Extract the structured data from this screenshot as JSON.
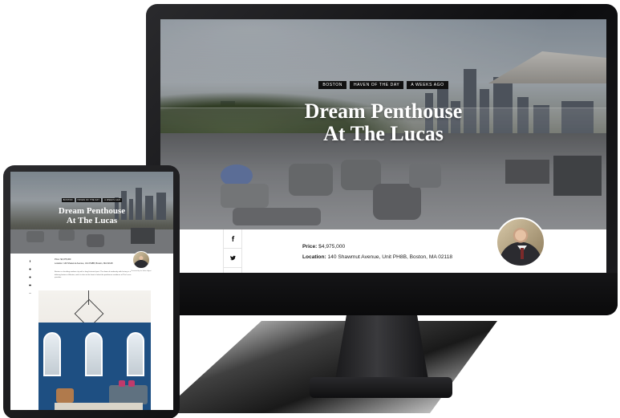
{
  "desktop": {
    "tags": [
      "Boston",
      "Haven of the Day",
      "A Weeks Ago"
    ],
    "title_line1": "Dream Penthouse",
    "title_line2": "At The Lucas",
    "price_label": "Price:",
    "price_value": "$4,975,000",
    "location_label": "Location:",
    "location_value": "140 Shawmut Avenue, Unit PH8B, Boston, MA 02118",
    "social": [
      {
        "icon": "facebook-icon",
        "glyph": "f"
      },
      {
        "icon": "twitter-icon",
        "glyph": "t"
      }
    ]
  },
  "tablet": {
    "tags": [
      "Boston",
      "Haven of the Day",
      "A Weeks Ago"
    ],
    "title_line1": "Dream Penthouse",
    "title_line2": "At The Lucas",
    "info_price": "Price: $4,975,000",
    "info_location": "Location: 140 Shawmut Avenue, Unit PH8B, Boston, MA 02118",
    "paragraph": "Boston is a bustling modern city with a long historical past. The dawn of modernity with history is a defining feature of Boston, and it is also at the heart of what the penthouse residence at The Lucas provides.",
    "agent_caption": "Presented by the Seller's Agent"
  },
  "colors": {
    "tag_bg": "#111111",
    "hero_text": "#ffffff",
    "device_frame": "#1a1a1c"
  }
}
